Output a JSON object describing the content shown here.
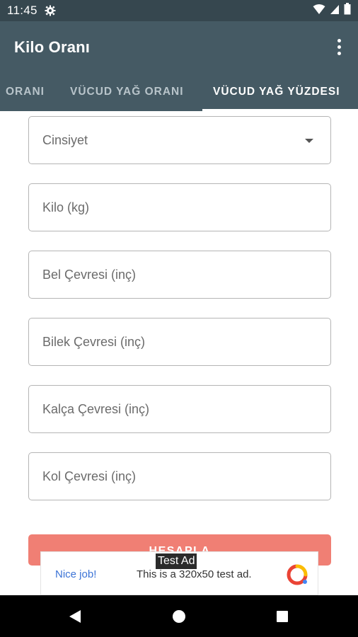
{
  "status_bar": {
    "time": "11:45",
    "icons": [
      "gear-icon",
      "wifi-icon",
      "signal-icon",
      "battery-icon"
    ]
  },
  "app_bar": {
    "title": "Kilo Oranı",
    "overflow_icon": "more-vert-icon"
  },
  "tabs": [
    {
      "label": "ORANI",
      "active": false
    },
    {
      "label": "VÜCUD YAĞ ORANI",
      "active": false
    },
    {
      "label": "VÜCUD YAĞ YÜZDESI",
      "active": true
    }
  ],
  "form": {
    "gender_dropdown": {
      "placeholder": "Cinsiyet",
      "icon": "dropdown-arrow-icon"
    },
    "fields": [
      {
        "placeholder": "Kilo (kg)"
      },
      {
        "placeholder": "Bel Çevresi (inç)"
      },
      {
        "placeholder": "Bilek Çevresi (inç)"
      },
      {
        "placeholder": "Kalça Çevresi (inç)"
      },
      {
        "placeholder": "Kol Çevresi (inç)"
      }
    ],
    "submit_label": "HESAPLA"
  },
  "ad": {
    "badge": "Test Ad",
    "nice_text": "Nice job!",
    "description": "This is a 320x50 test ad.",
    "logo_icon": "admob-logo-icon"
  },
  "nav_bar": {
    "icons": [
      "back-icon",
      "home-icon",
      "recents-icon"
    ]
  },
  "colors": {
    "status_bar": "#36474f",
    "app_bar": "#455a64",
    "accent_button": "#f07f74",
    "ad_link": "#3b73d6"
  }
}
